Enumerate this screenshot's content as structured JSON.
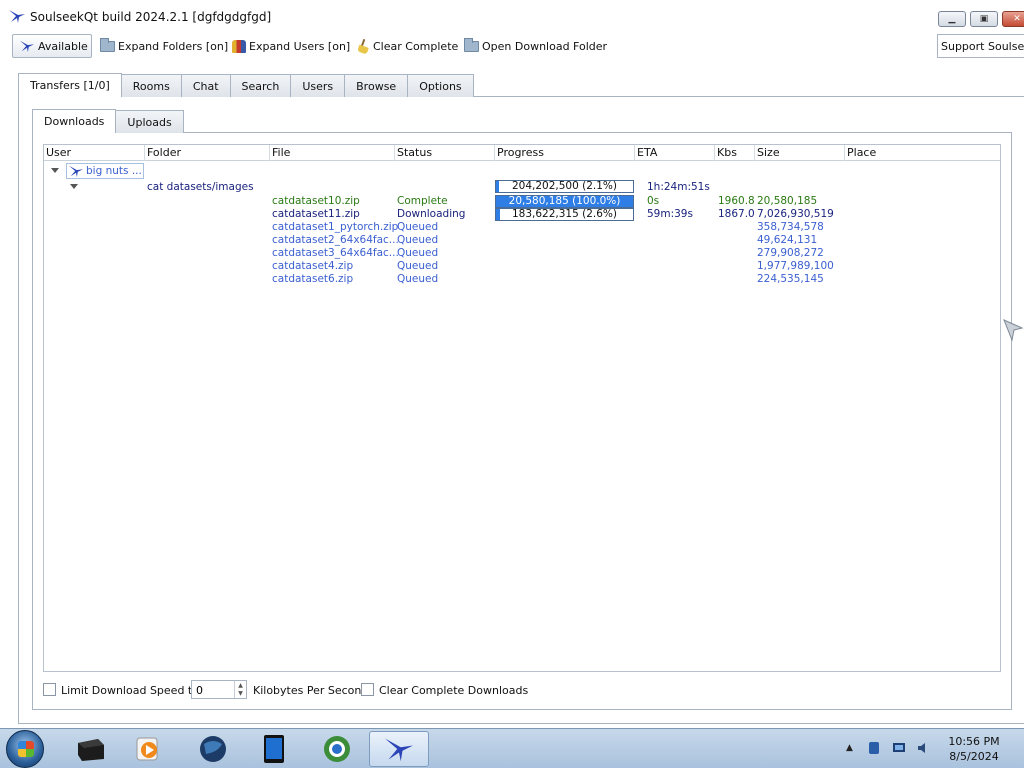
{
  "window": {
    "title": "SoulseekQt build 2024.2.1 [dgfdgdgfgd]"
  },
  "toolbar": {
    "available": "Available",
    "expand_folders": "Expand Folders [on]",
    "expand_users": "Expand Users [on]",
    "clear_complete": "Clear Complete",
    "open_download_folder": "Open Download Folder",
    "support": "Support Soulseek"
  },
  "main_tabs": [
    "Transfers [1/0]",
    "Rooms",
    "Chat",
    "Search",
    "Users",
    "Browse",
    "Options"
  ],
  "sub_tabs": [
    "Downloads",
    "Uploads"
  ],
  "columns": [
    "User",
    "Folder",
    "File",
    "Status",
    "Progress",
    "ETA",
    "Kbs",
    "Size",
    "Place"
  ],
  "user_group": {
    "user": "big nuts ...",
    "folder": "cat datasets/images",
    "progress_text": "204,202,500 (2.1%)",
    "progress_fraction": 0.021,
    "eta": "1h:24m:51s"
  },
  "files": [
    {
      "file": "catdataset10.zip",
      "status": "Complete",
      "progress_text": "20,580,185 (100.0%)",
      "progress_fraction": 1.0,
      "eta": "0s",
      "kbs": "1960.8",
      "size": "20,580,185",
      "style": "complete"
    },
    {
      "file": "catdataset11.zip",
      "status": "Downloading",
      "progress_text": "183,622,315 (2.6%)",
      "progress_fraction": 0.026,
      "eta": "59m:39s",
      "kbs": "1867.0",
      "size": "7,026,930,519",
      "style": "downloading"
    },
    {
      "file": "catdataset1_pytorch.zip",
      "status": "Queued",
      "progress_text": "",
      "eta": "",
      "kbs": "",
      "size": "358,734,578",
      "style": "queued"
    },
    {
      "file": "catdataset2_64x64fac...",
      "status": "Queued",
      "progress_text": "",
      "eta": "",
      "kbs": "",
      "size": "49,624,131",
      "style": "queued"
    },
    {
      "file": "catdataset3_64x64fac...",
      "status": "Queued",
      "progress_text": "",
      "eta": "",
      "kbs": "",
      "size": "279,908,272",
      "style": "queued"
    },
    {
      "file": "catdataset4.zip",
      "status": "Queued",
      "progress_text": "",
      "eta": "",
      "kbs": "",
      "size": "1,977,989,100",
      "style": "queued"
    },
    {
      "file": "catdataset6.zip",
      "status": "Queued",
      "progress_text": "",
      "eta": "",
      "kbs": "",
      "size": "224,535,145",
      "style": "queued"
    }
  ],
  "bottom": {
    "limit_label": "Limit Download Speed to",
    "speed_value": "0",
    "units_label": "Kilobytes Per Second",
    "clear_complete_downloads": "Clear Complete Downloads"
  },
  "taskbar": {
    "time": "10:56 PM",
    "date": "8/5/2024"
  },
  "colors": {
    "complete": "#2a7a14",
    "downloading": "#1a237e",
    "queued": "#3a5fd0",
    "progress_fill": "#2f7ee5"
  }
}
